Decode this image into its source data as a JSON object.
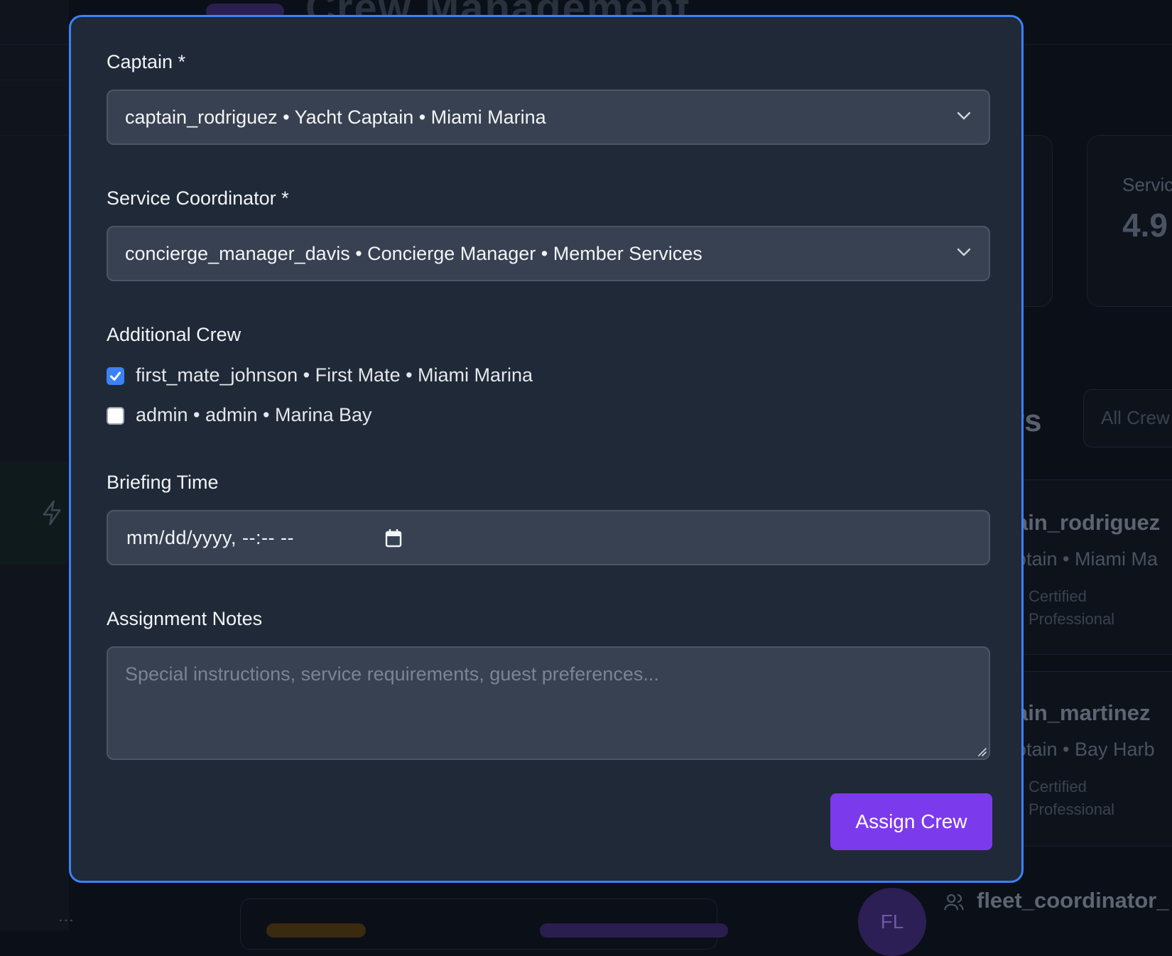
{
  "background": {
    "header_text": "Crew Management",
    "stat_label": "Servic",
    "stat_value": "4.9",
    "section_title_fragment": "rs",
    "filter_button": "All Crew",
    "members": [
      {
        "name": "ain_rodriguez",
        "subtitle": "otain • Miami Ma",
        "badge_line1": "Certified",
        "badge_line2": "Professional"
      },
      {
        "name": "ain_martinez",
        "subtitle": "otain • Bay Harb",
        "badge_line1": "Certified",
        "badge_line2": "Professional"
      }
    ],
    "bottom_member": {
      "avatar_initials": "FL",
      "name": "fleet_coordinator_"
    }
  },
  "modal": {
    "captain": {
      "label": "Captain *",
      "selected": "captain_rodriguez • Yacht Captain • Miami Marina",
      "icon": "chevron-down-icon"
    },
    "coordinator": {
      "label": "Service Coordinator *",
      "selected": "concierge_manager_davis • Concierge Manager • Member Services",
      "icon": "chevron-down-icon"
    },
    "additional_crew": {
      "label": "Additional Crew",
      "options": [
        {
          "label": "first_mate_johnson • First Mate • Miami Marina",
          "checked": true
        },
        {
          "label": "admin • admin • Marina Bay",
          "checked": false
        }
      ]
    },
    "briefing_time": {
      "label": "Briefing Time",
      "value": "mm/dd/yyyy, --:-- --",
      "icon": "calendar-icon"
    },
    "notes": {
      "label": "Assignment Notes",
      "placeholder": "Special instructions, service requirements, guest preferences..."
    },
    "submit_label": "Assign Crew"
  },
  "colors": {
    "modal_bg": "#1f2937",
    "modal_border": "#3b82f6",
    "field_bg": "#374151",
    "accent_button": "#7c3aed",
    "checkbox_checked": "#3b82f6"
  }
}
